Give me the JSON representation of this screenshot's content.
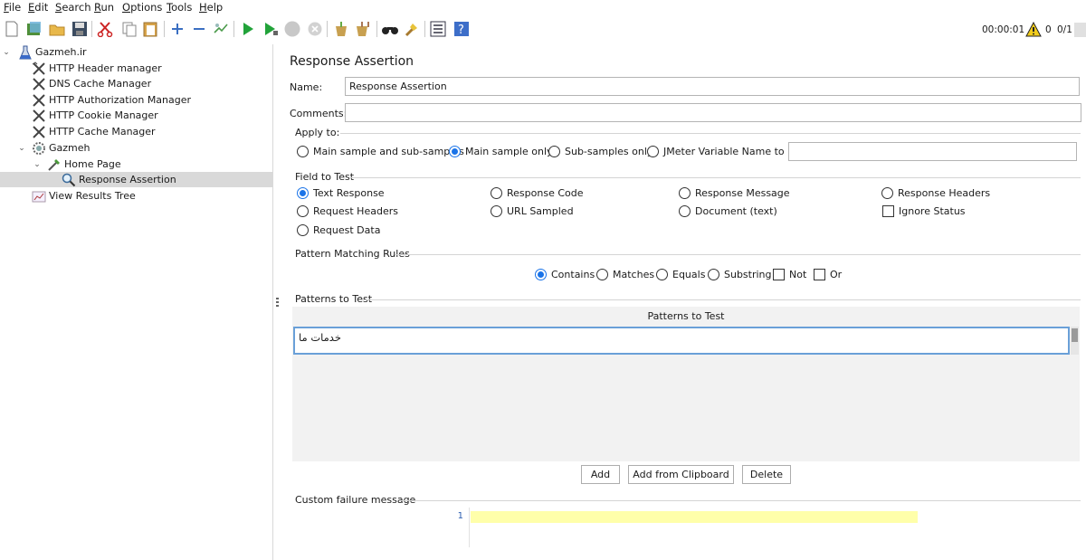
{
  "menu": [
    "File",
    "Edit",
    "Search",
    "Run",
    "Options",
    "Tools",
    "Help"
  ],
  "toolbar": {
    "icons": [
      "new-icon",
      "templates-icon",
      "open-icon",
      "save-icon",
      "cut-icon",
      "copy-icon",
      "paste-icon",
      "expand-icon",
      "collapse-icon",
      "toggle-icon",
      "start-icon",
      "start-no-pause-icon",
      "stop-icon",
      "shutdown-icon",
      "clear-icon",
      "clear-all-icon",
      "search-icon",
      "reset-search-icon",
      "function-helper-icon",
      "help-icon"
    ],
    "timer": "00:00:01",
    "warn_count": "0",
    "threads": "0/1"
  },
  "tree": {
    "items": [
      {
        "label": "Gazmeh.ir",
        "icon": "test-plan-icon"
      },
      {
        "label": "HTTP Header manager",
        "icon": "config-tools-icon"
      },
      {
        "label": "DNS Cache Manager",
        "icon": "config-tools-icon"
      },
      {
        "label": "HTTP Authorization Manager",
        "icon": "config-tools-icon"
      },
      {
        "label": "HTTP Cookie Manager",
        "icon": "config-tools-icon"
      },
      {
        "label": "HTTP Cache Manager",
        "icon": "config-tools-icon"
      },
      {
        "label": "Gazmeh",
        "icon": "thread-group-gear-icon"
      },
      {
        "label": "Home Page",
        "icon": "sampler-pipette-icon"
      },
      {
        "label": "Response Assertion",
        "icon": "magnifier-icon"
      },
      {
        "label": "View Results Tree",
        "icon": "listener-chart-icon"
      }
    ]
  },
  "editor": {
    "title": "Response Assertion",
    "name_label": "Name:",
    "name_value": "Response Assertion",
    "comments_label": "Comments:",
    "comments_value": "",
    "apply_to": {
      "label": "Apply to:",
      "options": [
        "Main sample and sub-samples",
        "Main sample only",
        "Sub-samples only",
        "JMeter Variable Name to use"
      ],
      "selected": "Main sample only",
      "variable_value": ""
    },
    "field_to_test": {
      "label": "Field to Test",
      "options": [
        "Text Response",
        "Response Code",
        "Response Message",
        "Response Headers",
        "Request Headers",
        "URL Sampled",
        "Document (text)",
        "Request Data"
      ],
      "checkbox": "Ignore Status",
      "selected": "Text Response"
    },
    "pattern_rules": {
      "label": "Pattern Matching Rules",
      "options": [
        "Contains",
        "Matches",
        "Equals",
        "Substring"
      ],
      "checkboxes": [
        "Not",
        "Or"
      ],
      "selected": "Contains"
    },
    "patterns": {
      "label": "Patterns to Test",
      "column": "Patterns to Test",
      "rows": [
        "خدمات ما"
      ]
    },
    "buttons": {
      "add": "Add",
      "add_clipboard": "Add from Clipboard",
      "delete": "Delete"
    },
    "failure": {
      "label": "Custom failure message",
      "line_number": "1"
    }
  }
}
